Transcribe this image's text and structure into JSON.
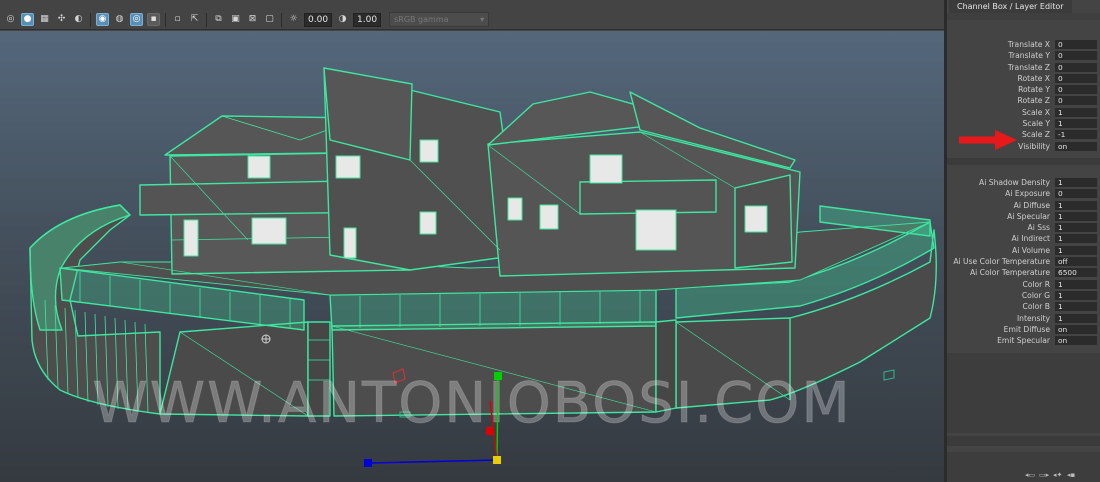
{
  "viewport_toolbar": {
    "exposure_value": "0.00",
    "gamma_value": "1.00",
    "color_space": "sRGB gamma",
    "icons": [
      "isolate-icon",
      "shaded-icon",
      "wireframe-icon",
      "textured-icon",
      "lights-icon",
      "shadows-icon",
      "ambient-occlusion-icon",
      "motion-blur-icon",
      "anti-alias-icon",
      "depth-of-field-icon",
      "camera-select-icon",
      "resolution-gate-icon",
      "gate-mask-icon",
      "film-gate-icon",
      "safe-action-icon",
      "exposure-icon",
      "gamma-icon"
    ]
  },
  "viewport": {
    "watermark": "WWW.ANTONIOBOSI.COM",
    "wire_color": "#3ee6a0",
    "manipulator_colors": {
      "y": "#00d000",
      "x": "#0000dd",
      "z": "#dd0000",
      "center": "#e8d000"
    }
  },
  "panel": {
    "title": "Channel Box / Layer Editor",
    "transform_attrs": [
      {
        "label": "Translate X",
        "value": "0"
      },
      {
        "label": "Translate Y",
        "value": "0"
      },
      {
        "label": "Translate Z",
        "value": "0"
      },
      {
        "label": "Rotate X",
        "value": "0"
      },
      {
        "label": "Rotate Y",
        "value": "0"
      },
      {
        "label": "Rotate Z",
        "value": "0"
      },
      {
        "label": "Scale X",
        "value": "1"
      },
      {
        "label": "Scale Y",
        "value": "1"
      },
      {
        "label": "Scale Z",
        "value": "-1"
      },
      {
        "label": "Visibility",
        "value": "on"
      }
    ],
    "light_attrs": [
      {
        "label": "Ai Shadow Density",
        "value": "1"
      },
      {
        "label": "Ai Exposure",
        "value": "0"
      },
      {
        "label": "Ai Diffuse",
        "value": "1"
      },
      {
        "label": "Ai Specular",
        "value": "1"
      },
      {
        "label": "Ai Sss",
        "value": "1"
      },
      {
        "label": "Ai Indirect",
        "value": "1"
      },
      {
        "label": "Ai Volume",
        "value": "1"
      },
      {
        "label": "Ai Use Color Temperature",
        "value": "off"
      },
      {
        "label": "Ai Color Temperature",
        "value": "6500"
      },
      {
        "label": "Color R",
        "value": "1"
      },
      {
        "label": "Color G",
        "value": "1"
      },
      {
        "label": "Color B",
        "value": "1"
      },
      {
        "label": "Intensity",
        "value": "1"
      },
      {
        "label": "Emit Diffuse",
        "value": "on"
      },
      {
        "label": "Emit Specular",
        "value": "on"
      }
    ],
    "highlight_arrow_color": "#e8191b",
    "bottom_icons": [
      "layer-prev-icon",
      "layer-next-icon",
      "layer-new-icon",
      "layer-options-icon"
    ]
  }
}
